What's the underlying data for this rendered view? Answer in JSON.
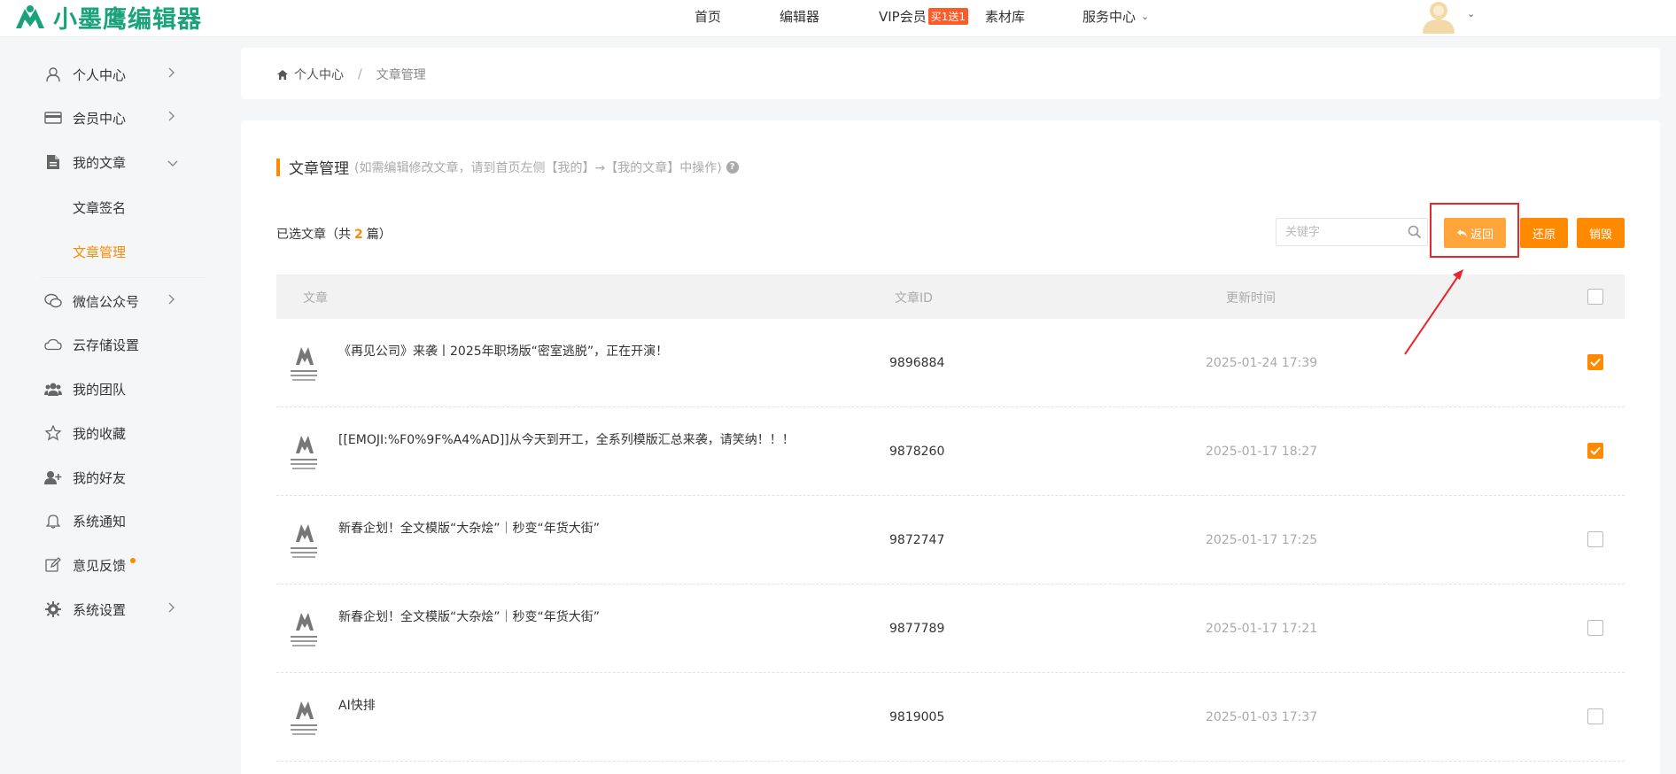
{
  "brand": {
    "name": "小墨鹰编辑器",
    "color": "#1aa37a"
  },
  "nav": {
    "home": "首页",
    "editor": "编辑器",
    "vip": "VIP会员",
    "vip_badge": "买1送1",
    "materials": "素材库",
    "service": "服务中心"
  },
  "sidebar": {
    "items": [
      {
        "label": "个人中心",
        "icon": "user-icon"
      },
      {
        "label": "会员中心",
        "icon": "card-icon"
      },
      {
        "label": "我的文章",
        "icon": "document-icon"
      },
      {
        "label": "微信公众号",
        "icon": "wechat-icon"
      },
      {
        "label": "云存储设置",
        "icon": "cloud-icon"
      },
      {
        "label": "我的团队",
        "icon": "team-icon"
      },
      {
        "label": "我的收藏",
        "icon": "star-icon"
      },
      {
        "label": "我的好友",
        "icon": "add-friend-icon"
      },
      {
        "label": "系统通知",
        "icon": "bell-icon"
      },
      {
        "label": "意见反馈",
        "icon": "edit-icon"
      },
      {
        "label": "系统设置",
        "icon": "gear-icon"
      }
    ],
    "subitems": [
      {
        "label": "文章签名"
      },
      {
        "label": "文章管理",
        "active": true
      }
    ]
  },
  "breadcrumb": {
    "home": "个人中心",
    "sep": "/",
    "current": "文章管理"
  },
  "section": {
    "title": "文章管理",
    "hint": "(如需编辑修改文章，请到首页左侧【我的】→【我的文章】中操作)"
  },
  "selection": {
    "prefix": "已选文章（共",
    "count": "2",
    "suffix": "篇）"
  },
  "search": {
    "placeholder": "关键字"
  },
  "buttons": {
    "back": "返回",
    "restore": "还原",
    "destroy": "销毁"
  },
  "table": {
    "headers": {
      "article": "文章",
      "id": "文章ID",
      "time": "更新时间"
    },
    "rows": [
      {
        "title": "《再见公司》来袭丨2025年职场版“密室逃脱”，正在开演！",
        "id": "9896884",
        "time": "2025-01-24 17:39",
        "checked": true
      },
      {
        "title": "[[EMOJI:%F0%9F%A4%AD]]从今天到开工，全系列模版汇总来袭，请笑纳！！！",
        "id": "9878260",
        "time": "2025-01-17 18:27",
        "checked": true
      },
      {
        "title": "新春企划！全文模版“大杂烩”｜秒变“年货大街”",
        "id": "9872747",
        "time": "2025-01-17 17:25",
        "checked": false
      },
      {
        "title": "新春企划！全文模版“大杂烩”｜秒变“年货大街”",
        "id": "9877789",
        "time": "2025-01-17 17:21",
        "checked": false
      },
      {
        "title": "AI快排",
        "id": "9819005",
        "time": "2025-01-03 17:37",
        "checked": false
      }
    ]
  },
  "colors": {
    "accent": "#ff8a00",
    "annotation": "#e8262d"
  }
}
